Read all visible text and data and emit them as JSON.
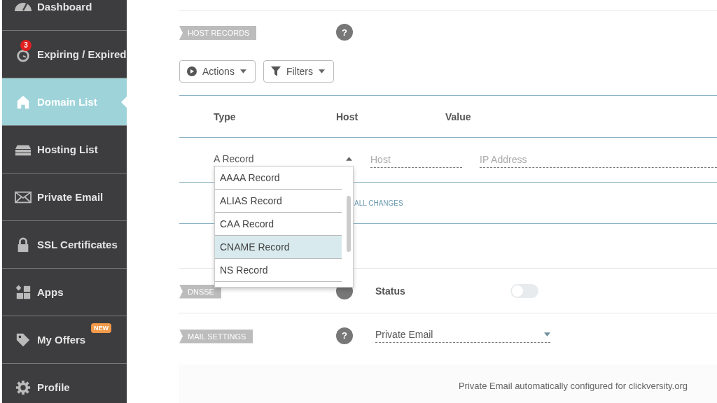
{
  "sidebar": {
    "items": [
      {
        "label": "Dashboard",
        "selected": false
      },
      {
        "label": "Expiring / Expired",
        "selected": false,
        "badge": "3"
      },
      {
        "label": "Domain List",
        "selected": true
      },
      {
        "label": "Hosting List",
        "selected": false
      },
      {
        "label": "Private Email",
        "selected": false
      },
      {
        "label": "SSL Certificates",
        "selected": false
      },
      {
        "label": "Apps",
        "selected": false
      },
      {
        "label": "My Offers",
        "selected": false,
        "tag": "NEW"
      },
      {
        "label": "Profile",
        "selected": false
      }
    ]
  },
  "host_records": {
    "label": "HOST RECORDS",
    "help": "?",
    "actions_button": "Actions",
    "filters_button": "Filters",
    "columns": [
      "Type",
      "Host",
      "Value"
    ],
    "new_record": {
      "type_value": "A Record",
      "expanded": true,
      "host_placeholder": "Host",
      "value_placeholder": "IP Address"
    },
    "dropdown_options": [
      {
        "label": "AAAA Record",
        "selected": false
      },
      {
        "label": "ALIAS Record",
        "selected": false
      },
      {
        "label": "CAA Record",
        "selected": false
      },
      {
        "label": "CNAME Record",
        "selected": true
      },
      {
        "label": "NS Record",
        "selected": false
      }
    ],
    "save_button": "ALL CHANGES"
  },
  "dnssec": {
    "label": "DNSSE",
    "status_label": "Status",
    "on": false
  },
  "mail_settings": {
    "label": "MAIL SETTINGS",
    "help": "?",
    "value": "Private Email"
  },
  "footer_note": "Private Email automatically configured for clickversity.org"
}
